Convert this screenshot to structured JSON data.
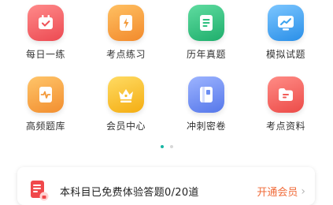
{
  "grid": {
    "items": [
      {
        "label": "每日一练",
        "icon": "calendar-check-icon",
        "color": "#f2595e"
      },
      {
        "label": "考点练习",
        "icon": "lightning-doc-icon",
        "color": "#f59a3a"
      },
      {
        "label": "历年真题",
        "icon": "doc-list-icon",
        "color": "#2cc07f"
      },
      {
        "label": "模拟试题",
        "icon": "monitor-chart-icon",
        "color": "#3aa3ef"
      },
      {
        "label": "高频题库",
        "icon": "heartbeat-doc-icon",
        "color": "#f5a53c"
      },
      {
        "label": "会员中心",
        "icon": "crown-icon",
        "color": "#f6be2c"
      },
      {
        "label": "冲刺密卷",
        "icon": "book-icon",
        "color": "#6d8ef2"
      },
      {
        "label": "考点资料",
        "icon": "folder-icon",
        "color": "#f25c57"
      }
    ]
  },
  "pager": {
    "pages": 2,
    "active": 1
  },
  "banner": {
    "text": "本科目已免费体验答题0/20道",
    "link": "开通会员",
    "icon": "doc-lock-icon"
  }
}
